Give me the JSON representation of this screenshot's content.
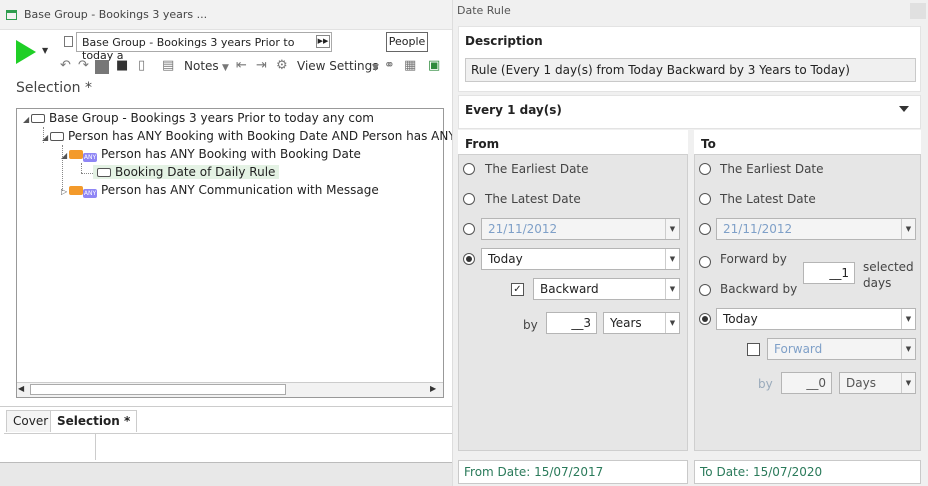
{
  "window": {
    "title": "Base Group - Bookings 3 years ..."
  },
  "toolbar": {
    "selection_name": "Base Group - Bookings 3 years Prior to today a",
    "people_label": "People",
    "notes_label": "Notes",
    "view_settings_label": "View Settings"
  },
  "selection_title": "Selection *",
  "tree": {
    "root": "Base Group - Bookings 3 years Prior to today any com",
    "child1": "Person has ANY Booking with Booking Date AND Person has ANY",
    "child1_1": "Person has ANY Booking with Booking Date",
    "child1_1_1": "Booking Date of Daily Rule",
    "child1_2": "Person has ANY Communication with Message"
  },
  "tabs": {
    "cover": "Cover",
    "selection": "Selection *"
  },
  "dialog": {
    "title": "Date Rule",
    "description_label": "Description",
    "description_value": "Rule (Every 1 day(s) from Today Backward by 3 Years to Today)",
    "frequency_label": "Every 1 day(s)",
    "from": {
      "label": "From",
      "earliest": "The Earliest Date",
      "latest": "The Latest Date",
      "date_value": "21/11/2012",
      "today": "Today",
      "direction": "Backward",
      "by_label": "by",
      "by_value": "__3",
      "unit": "Years"
    },
    "to": {
      "label": "To",
      "earliest": "The Earliest Date",
      "latest": "The Latest Date",
      "date_value": "21/11/2012",
      "forward_by": "Forward by",
      "backward_by": "Backward by",
      "days_value": "__1",
      "selected_days": "selected",
      "days_word": "days",
      "today": "Today",
      "direction": "Forward",
      "by_label": "by",
      "by_value": "__0",
      "unit": "Days"
    },
    "from_date": "From Date: 15/07/2017",
    "to_date": "To Date: 15/07/2020"
  }
}
